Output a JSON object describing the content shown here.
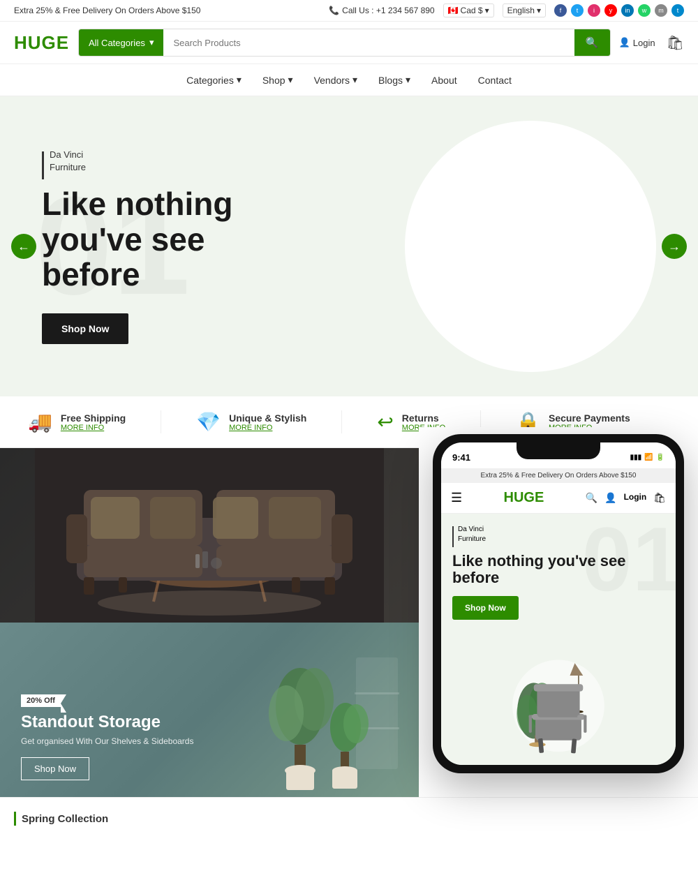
{
  "topbar": {
    "promo": "Extra 25% & Free Delivery On Orders Above $150",
    "phone_label": "Call Us : +1 234 567 890",
    "currency": "Cad $",
    "language": "English",
    "social": [
      "f",
      "t",
      "i",
      "y",
      "in",
      "w",
      "m",
      "t2"
    ]
  },
  "header": {
    "logo": "HUGE",
    "categories_label": "All Categories",
    "search_placeholder": "Search Products",
    "search_icon": "🔍",
    "login_label": "Login",
    "cart_icon": "🛍"
  },
  "nav": {
    "items": [
      {
        "label": "Categories",
        "has_dropdown": true
      },
      {
        "label": "Shop",
        "has_dropdown": true
      },
      {
        "label": "Vendors",
        "has_dropdown": true
      },
      {
        "label": "Blogs",
        "has_dropdown": true
      },
      {
        "label": "About",
        "has_dropdown": false
      },
      {
        "label": "Contact",
        "has_dropdown": false
      }
    ]
  },
  "hero": {
    "number": "01",
    "brand": "Da Vinci\nFurniture",
    "title": "Like nothing you've see before",
    "shop_now": "Shop Now",
    "nav_left": "←",
    "nav_right": "→"
  },
  "features": [
    {
      "icon": "🚚",
      "title": "Free Shipping",
      "more_info": "MORE INFO"
    },
    {
      "icon": "💎",
      "title": "Unique & Stylish",
      "more_info": "MORE INFO"
    },
    {
      "icon": "↩",
      "title": "Returns",
      "more_info": "MORE INFO"
    },
    {
      "icon": "🔒",
      "title": "Secure Payments",
      "more_info": "MORE INFO"
    }
  ],
  "storage_banner": {
    "discount": "20% Off",
    "title": "Standout Storage",
    "subtitle": "Get organised With Our Shelves & Sideboards",
    "shop_now": "Shop Now"
  },
  "phone_mockup": {
    "status_time": "9:41",
    "promo": "Extra 25% & Free Delivery On Orders Above $150",
    "logo": "HUGE",
    "login": "Login",
    "brand": "Da Vinci\nFurniture",
    "title": "Like nothing you've see before",
    "shop_now": "Shop Now"
  },
  "spring": {
    "label": "Spring Collection"
  }
}
